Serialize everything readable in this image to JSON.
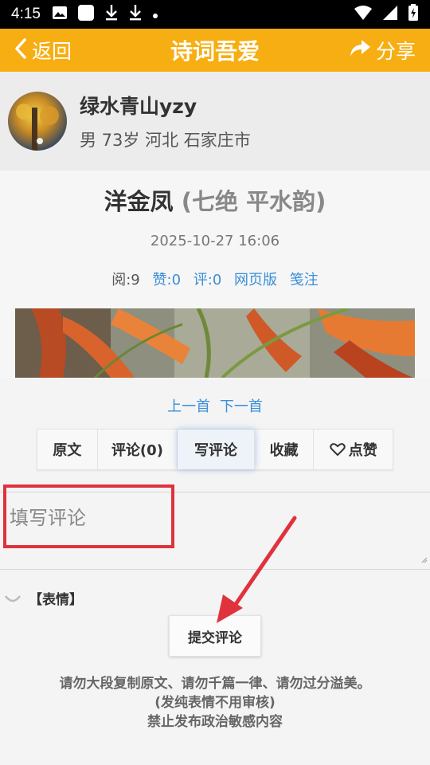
{
  "status_bar": {
    "time": "4:15",
    "icons": [
      "image-icon",
      "blank-app-icon",
      "download-icon",
      "download-icon",
      "dot-icon"
    ],
    "right_icons": [
      "wifi-icon",
      "signal-icon",
      "battery-icon"
    ]
  },
  "app_bar": {
    "back_label": "返回",
    "title": "诗词吾爱",
    "share_label": "分享"
  },
  "profile": {
    "name": "绿水青山yzy",
    "meta": "男 73岁 河北 石家庄市"
  },
  "poem": {
    "title": "洋金凤",
    "subtitle": "(七绝 平水韵)",
    "date": "2025-10-27 16:06",
    "stats": {
      "reads": "阅:9",
      "likes": "赞:0",
      "comments": "评:0",
      "web": "网页版",
      "notes": "笺注"
    }
  },
  "nav": {
    "prev": "上一首",
    "next": "下一首"
  },
  "tabs": [
    {
      "label": "原文"
    },
    {
      "label": "评论(0)"
    },
    {
      "label": "写评论"
    },
    {
      "label": "收藏"
    },
    {
      "label": "点赞"
    }
  ],
  "comment": {
    "placeholder": "填写评论"
  },
  "emoji": {
    "label": "【表情】"
  },
  "submit_label": "提交评论",
  "notice": {
    "line1": "请勿大段复制原文、请勿千篇一律、请勿过分溢美。",
    "line2": "(发纯表情不用审核)",
    "line3": "禁止发布政治敏感内容"
  },
  "colors": {
    "accent": "#f7ae12",
    "link": "#3a8ed8",
    "highlight": "#e0323d"
  }
}
